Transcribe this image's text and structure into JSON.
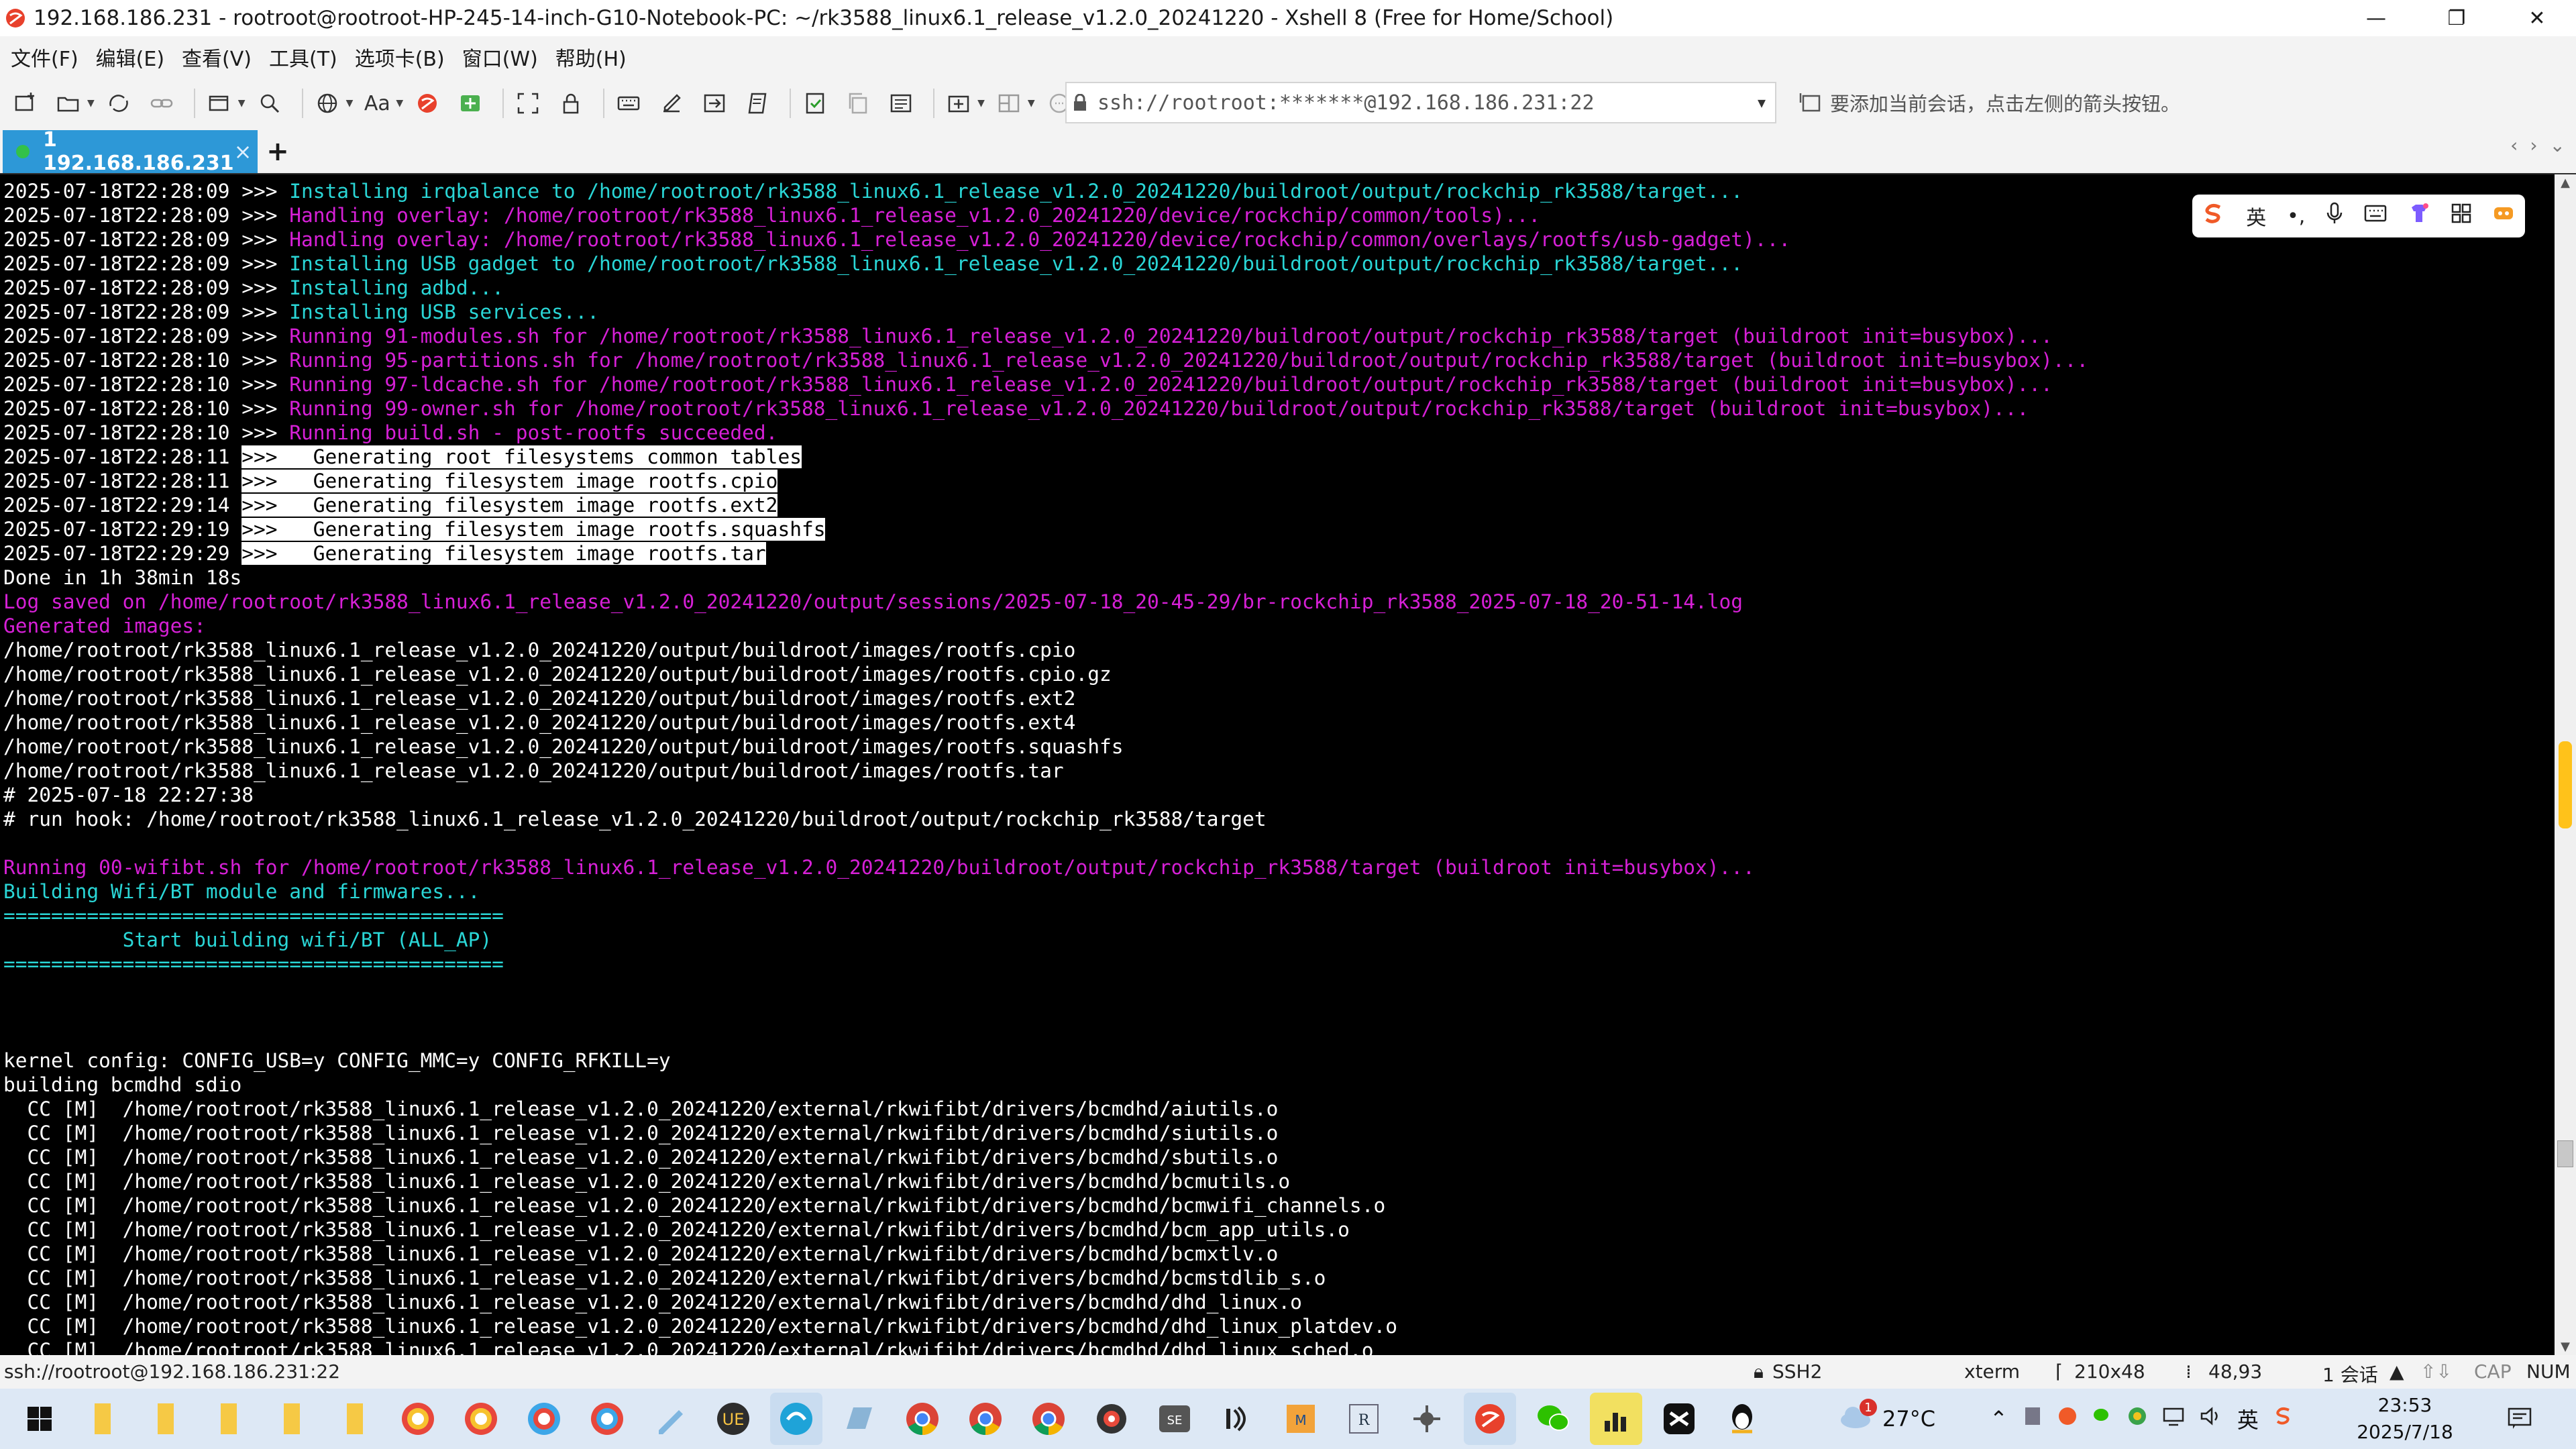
{
  "window": {
    "title": "192.168.186.231 - rootroot@rootroot-HP-245-14-inch-G10-Notebook-PC: ~/rk3588_linux6.1_release_v1.2.0_20241220 - Xshell 8 (Free for Home/School)",
    "minimize": "—",
    "maximize": "❐",
    "close": "✕"
  },
  "menu": [
    "文件(F)",
    "编辑(E)",
    "查看(V)",
    "工具(T)",
    "选项卡(B)",
    "窗口(W)",
    "帮助(H)"
  ],
  "toolbar": {
    "font_label": "Aa",
    "address": "ssh://rootroot:*******@192.168.186.231:22",
    "hint": "要添加当前会话，点击左侧的箭头按钮。"
  },
  "tabs": [
    {
      "label": "1 192.168.186.231",
      "close": "×"
    }
  ],
  "tab_add": "+",
  "tab_nav": [
    "‹",
    "›",
    "⌄"
  ],
  "terminal": {
    "lines": [
      {
        "p": "2025-07-18T22:28:09 >>> ",
        "t": "Installing irqbalance to /home/rootroot/rk3588_linux6.1_release_v1.2.0_20241220/buildroot/output/rockchip_rk3588/target...",
        "c": "c"
      },
      {
        "p": "2025-07-18T22:28:09 >>> ",
        "t": "Handling overlay: /home/rootroot/rk3588_linux6.1_release_v1.2.0_20241220/device/rockchip/common/tools)...",
        "c": "m"
      },
      {
        "p": "2025-07-18T22:28:09 >>> ",
        "t": "Handling overlay: /home/rootroot/rk3588_linux6.1_release_v1.2.0_20241220/device/rockchip/common/overlays/rootfs/usb-gadget)...",
        "c": "m"
      },
      {
        "p": "2025-07-18T22:28:09 >>> ",
        "t": "Installing USB gadget to /home/rootroot/rk3588_linux6.1_release_v1.2.0_20241220/buildroot/output/rockchip_rk3588/target...",
        "c": "c"
      },
      {
        "p": "2025-07-18T22:28:09 >>> ",
        "t": "Installing adbd...",
        "c": "c"
      },
      {
        "p": "2025-07-18T22:28:09 >>> ",
        "t": "Installing USB services...",
        "c": "c"
      },
      {
        "p": "2025-07-18T22:28:09 >>> ",
        "t": "Running 91-modules.sh for /home/rootroot/rk3588_linux6.1_release_v1.2.0_20241220/buildroot/output/rockchip_rk3588/target (buildroot init=busybox)...",
        "c": "m"
      },
      {
        "p": "2025-07-18T22:28:10 >>> ",
        "t": "Running 95-partitions.sh for /home/rootroot/rk3588_linux6.1_release_v1.2.0_20241220/buildroot/output/rockchip_rk3588/target (buildroot init=busybox)...",
        "c": "m"
      },
      {
        "p": "2025-07-18T22:28:10 >>> ",
        "t": "Running 97-ldcache.sh for /home/rootroot/rk3588_linux6.1_release_v1.2.0_20241220/buildroot/output/rockchip_rk3588/target (buildroot init=busybox)...",
        "c": "m"
      },
      {
        "p": "2025-07-18T22:28:10 >>> ",
        "t": "Running 99-owner.sh for /home/rootroot/rk3588_linux6.1_release_v1.2.0_20241220/buildroot/output/rockchip_rk3588/target (buildroot init=busybox)...",
        "c": "m"
      },
      {
        "p": "2025-07-18T22:28:10 >>> ",
        "t": "Running build.sh - post-rootfs succeeded.",
        "c": "m"
      },
      {
        "p": "2025-07-18T22:28:11 ",
        "t": ">>>   Generating root filesystems common tables",
        "c": "hl"
      },
      {
        "p": "2025-07-18T22:28:11 ",
        "t": ">>>   Generating filesystem image rootfs.cpio",
        "c": "hl"
      },
      {
        "p": "2025-07-18T22:29:14 ",
        "t": ">>>   Generating filesystem image rootfs.ext2",
        "c": "hl"
      },
      {
        "p": "2025-07-18T22:29:19 ",
        "t": ">>>   Generating filesystem image rootfs.squashfs",
        "c": "hl"
      },
      {
        "p": "2025-07-18T22:29:29 ",
        "t": ">>>   Generating filesystem image rootfs.tar",
        "c": "hl"
      },
      {
        "p": "",
        "t": "Done in 1h 38min 18s",
        "c": "w"
      },
      {
        "p": "",
        "t": "Log saved on /home/rootroot/rk3588_linux6.1_release_v1.2.0_20241220/output/sessions/2025-07-18_20-45-29/br-rockchip_rk3588_2025-07-18_20-51-14.log",
        "c": "m"
      },
      {
        "p": "",
        "t": "Generated images:",
        "c": "m"
      },
      {
        "p": "",
        "t": "/home/rootroot/rk3588_linux6.1_release_v1.2.0_20241220/output/buildroot/images/rootfs.cpio",
        "c": "w"
      },
      {
        "p": "",
        "t": "/home/rootroot/rk3588_linux6.1_release_v1.2.0_20241220/output/buildroot/images/rootfs.cpio.gz",
        "c": "w"
      },
      {
        "p": "",
        "t": "/home/rootroot/rk3588_linux6.1_release_v1.2.0_20241220/output/buildroot/images/rootfs.ext2",
        "c": "w"
      },
      {
        "p": "",
        "t": "/home/rootroot/rk3588_linux6.1_release_v1.2.0_20241220/output/buildroot/images/rootfs.ext4",
        "c": "w"
      },
      {
        "p": "",
        "t": "/home/rootroot/rk3588_linux6.1_release_v1.2.0_20241220/output/buildroot/images/rootfs.squashfs",
        "c": "w"
      },
      {
        "p": "",
        "t": "/home/rootroot/rk3588_linux6.1_release_v1.2.0_20241220/output/buildroot/images/rootfs.tar",
        "c": "w"
      },
      {
        "p": "",
        "t": "# 2025-07-18 22:27:38",
        "c": "w"
      },
      {
        "p": "",
        "t": "# run hook: /home/rootroot/rk3588_linux6.1_release_v1.2.0_20241220/buildroot/output/rockchip_rk3588/target",
        "c": "w"
      },
      {
        "p": "",
        "t": "",
        "c": "w"
      },
      {
        "p": "",
        "t": "Running 00-wifibt.sh for /home/rootroot/rk3588_linux6.1_release_v1.2.0_20241220/buildroot/output/rockchip_rk3588/target (buildroot init=busybox)...",
        "c": "m"
      },
      {
        "p": "",
        "t": "Building Wifi/BT module and firmwares...",
        "c": "c"
      },
      {
        "p": "",
        "t": "==========================================",
        "c": "c"
      },
      {
        "p": "",
        "t": "          Start building wifi/BT (ALL_AP)",
        "c": "c"
      },
      {
        "p": "",
        "t": "==========================================",
        "c": "c"
      },
      {
        "p": "",
        "t": "",
        "c": "w"
      },
      {
        "p": "",
        "t": "",
        "c": "w"
      },
      {
        "p": "",
        "t": "",
        "c": "w"
      },
      {
        "p": "",
        "t": "kernel config: CONFIG_USB=y CONFIG_MMC=y CONFIG_RFKILL=y",
        "c": "w"
      },
      {
        "p": "",
        "t": "building bcmdhd sdio",
        "c": "w"
      },
      {
        "p": "",
        "t": "  CC [M]  /home/rootroot/rk3588_linux6.1_release_v1.2.0_20241220/external/rkwifibt/drivers/bcmdhd/aiutils.o",
        "c": "w"
      },
      {
        "p": "",
        "t": "  CC [M]  /home/rootroot/rk3588_linux6.1_release_v1.2.0_20241220/external/rkwifibt/drivers/bcmdhd/siutils.o",
        "c": "w"
      },
      {
        "p": "",
        "t": "  CC [M]  /home/rootroot/rk3588_linux6.1_release_v1.2.0_20241220/external/rkwifibt/drivers/bcmdhd/sbutils.o",
        "c": "w"
      },
      {
        "p": "",
        "t": "  CC [M]  /home/rootroot/rk3588_linux6.1_release_v1.2.0_20241220/external/rkwifibt/drivers/bcmdhd/bcmutils.o",
        "c": "w"
      },
      {
        "p": "",
        "t": "  CC [M]  /home/rootroot/rk3588_linux6.1_release_v1.2.0_20241220/external/rkwifibt/drivers/bcmdhd/bcmwifi_channels.o",
        "c": "w"
      },
      {
        "p": "",
        "t": "  CC [M]  /home/rootroot/rk3588_linux6.1_release_v1.2.0_20241220/external/rkwifibt/drivers/bcmdhd/bcm_app_utils.o",
        "c": "w"
      },
      {
        "p": "",
        "t": "  CC [M]  /home/rootroot/rk3588_linux6.1_release_v1.2.0_20241220/external/rkwifibt/drivers/bcmdhd/bcmxtlv.o",
        "c": "w"
      },
      {
        "p": "",
        "t": "  CC [M]  /home/rootroot/rk3588_linux6.1_release_v1.2.0_20241220/external/rkwifibt/drivers/bcmdhd/bcmstdlib_s.o",
        "c": "w"
      },
      {
        "p": "",
        "t": "  CC [M]  /home/rootroot/rk3588_linux6.1_release_v1.2.0_20241220/external/rkwifibt/drivers/bcmdhd/dhd_linux.o",
        "c": "w"
      },
      {
        "p": "",
        "t": "  CC [M]  /home/rootroot/rk3588_linux6.1_release_v1.2.0_20241220/external/rkwifibt/drivers/bcmdhd/dhd_linux_platdev.o",
        "c": "w"
      },
      {
        "p": "",
        "t": "  CC [M]  /home/rootroot/rk3588_linux6.1_release_v1.2.0_20241220/external/rkwifibt/drivers/bcmdhd/dhd_linux_sched.o",
        "c": "w"
      }
    ]
  },
  "ime": {
    "lang": "英",
    "punct": "•,"
  },
  "status": {
    "connection": "ssh://rootroot@192.168.186.231:22",
    "protocol": "SSH2",
    "term_type": "xterm",
    "size": "210x48",
    "cursor": "48,93",
    "sessions": "1 会话",
    "cap": "CAP",
    "num": "NUM"
  },
  "taskbar": {
    "weather_temp": "27°C",
    "weather_badge": "1",
    "time": "23:53",
    "date": "2025/7/18",
    "lang_indicator": "英"
  },
  "colors": {
    "magenta": "#d620d6",
    "cyan": "#2ad6d6",
    "tab_active": "#2d98d7",
    "scroll_thumb": "#ffc21a"
  }
}
